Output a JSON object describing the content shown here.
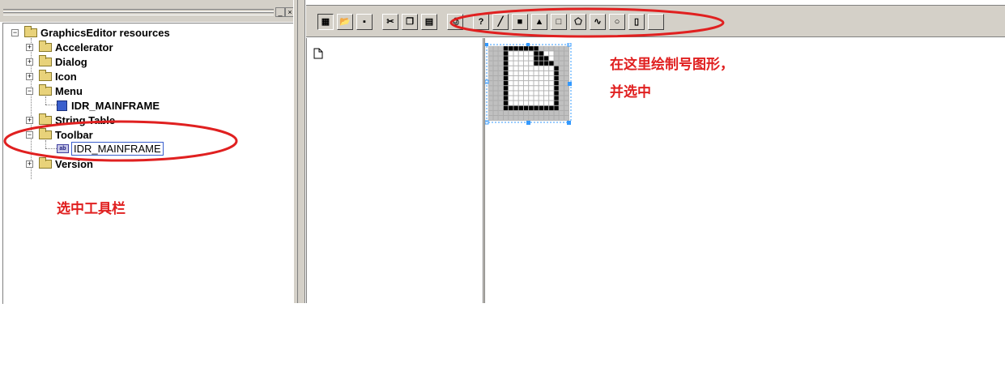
{
  "tree": {
    "root": "GraphicsEditor resources",
    "items": [
      {
        "label": "Accelerator"
      },
      {
        "label": "Dialog"
      },
      {
        "label": "Icon"
      },
      {
        "label": "Menu",
        "child": "IDR_MAINFRAME"
      },
      {
        "label": "String Table"
      },
      {
        "label": "Toolbar",
        "child": "IDR_MAINFRAME"
      },
      {
        "label": "Version"
      }
    ]
  },
  "toolbar_buttons": [
    "select-icon",
    "open-icon",
    "save-icon",
    "cut-icon",
    "copy-icon",
    "paste-icon",
    "print-icon",
    "help-icon",
    "line-icon",
    "filled-rect-icon",
    "triangle-icon",
    "rectangle-icon",
    "polygon-icon",
    "curve-icon",
    "ellipse-icon",
    "split-icon",
    "blank-icon"
  ],
  "annotations": {
    "select_toolbar": "选中工具栏",
    "draw_line1": "在这里绘制号图形，",
    "draw_line2": "并选中"
  },
  "colors": {
    "annotation": "#e02020",
    "selection": "#3399ff"
  }
}
